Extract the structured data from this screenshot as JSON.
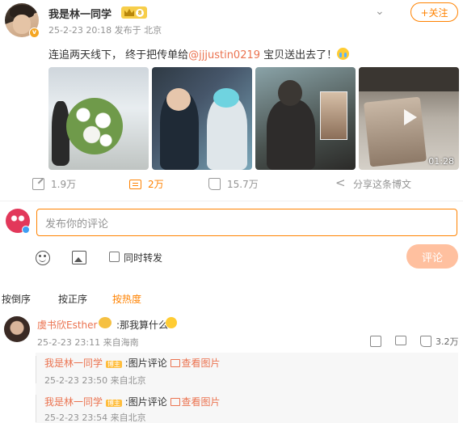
{
  "post": {
    "author": "我是林一同学",
    "timestamp": "25-2-23 20:18",
    "source": "发布于 北京",
    "follow_label": "+关注",
    "text_before": "连追两天线下， 终于把传单给",
    "mention": "@jjjustin0219",
    "text_after": " 宝贝送出去了！",
    "video_duration": "01:28"
  },
  "actions": {
    "repost": "1.9万",
    "comment": "2万",
    "like": "15.7万",
    "share": "分享这条博文"
  },
  "compose": {
    "placeholder": "发布你的评论",
    "sync_repost": "同时转发",
    "submit": "评论"
  },
  "sort": [
    "按倒序",
    "按正序",
    "按热度"
  ],
  "comment": {
    "author": "虞书欣Esther",
    "text": ":那我算什么",
    "meta": "25-2-23 23:11 来自海南",
    "likes": "3.2万"
  },
  "replies": [
    {
      "author": "我是林一同学",
      "tag": "博主",
      "text": ":图片评论",
      "link": "查看图片",
      "meta": "25-2-23 23:50 来自北京"
    },
    {
      "author": "我是林一同学",
      "tag": "博主",
      "text": ":图片评论",
      "link": "查看图片",
      "meta": "25-2-23 23:54 来自北京"
    }
  ],
  "colors": {
    "accent": "#ff8200",
    "link": "#eb7350",
    "meta": "#939393"
  }
}
